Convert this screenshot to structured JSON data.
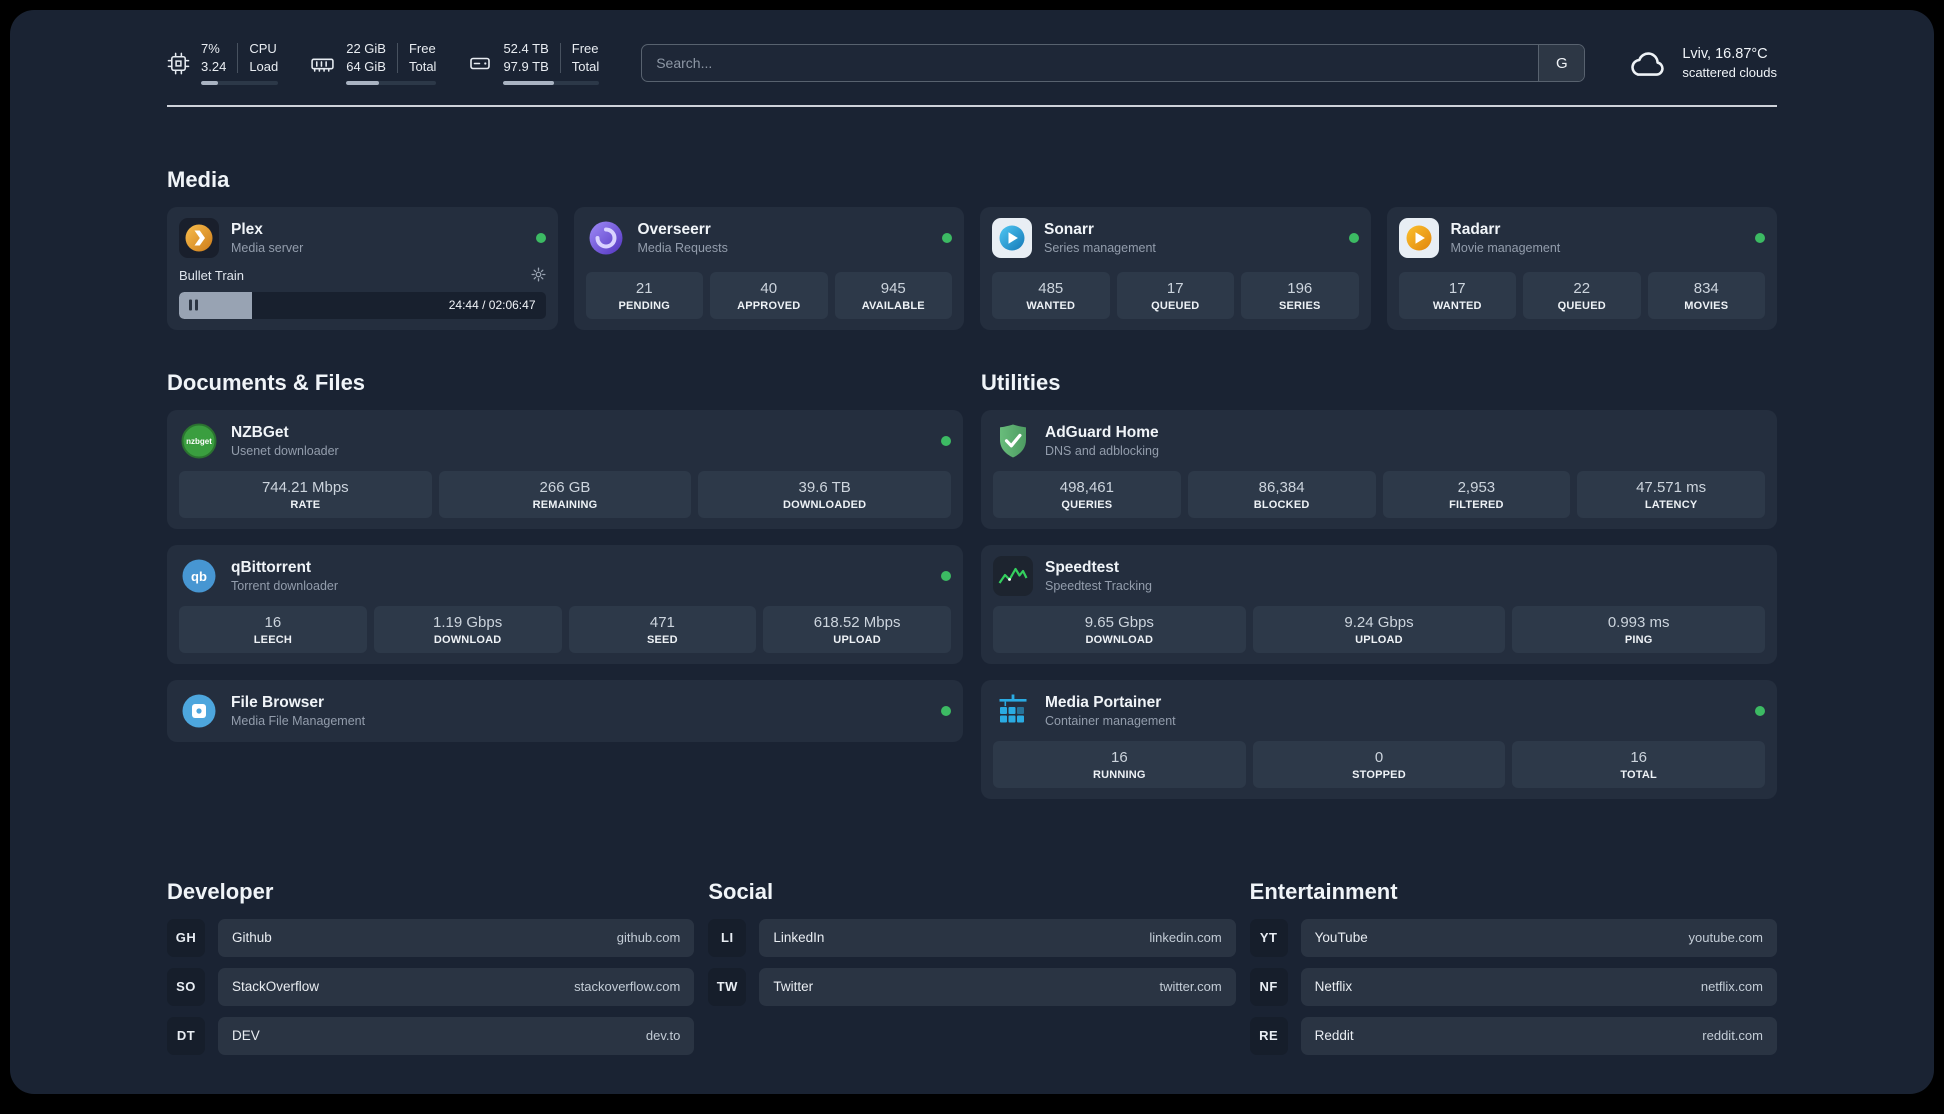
{
  "topbar": {
    "cpu": {
      "values": [
        "7%",
        "3.24"
      ],
      "labels": [
        "CPU",
        "Load"
      ],
      "progress": "22%"
    },
    "ram": {
      "values": [
        "22 GiB",
        "64 GiB"
      ],
      "labels": [
        "Free",
        "Total"
      ],
      "progress": "36%"
    },
    "disk": {
      "values": [
        "52.4 TB",
        "97.9 TB"
      ],
      "labels": [
        "Free",
        "Total"
      ],
      "progress": "53%"
    },
    "search": {
      "placeholder": "Search...",
      "button_label": "G"
    },
    "weather": {
      "location": "Lviv, 16.87°C",
      "condition": "scattered clouds"
    }
  },
  "sections": {
    "media": "Media",
    "documents": "Documents & Files",
    "utilities": "Utilities",
    "developer": "Developer",
    "social": "Social",
    "entertainment": "Entertainment"
  },
  "apps": {
    "plex": {
      "name": "Plex",
      "desc": "Media server",
      "now_playing": "Bullet Train",
      "time": "24:44 / 02:06:47",
      "progress": "20%"
    },
    "overseerr": {
      "name": "Overseerr",
      "desc": "Media Requests",
      "stats": [
        {
          "value": "21",
          "label": "PENDING"
        },
        {
          "value": "40",
          "label": "APPROVED"
        },
        {
          "value": "945",
          "label": "AVAILABLE"
        }
      ]
    },
    "sonarr": {
      "name": "Sonarr",
      "desc": "Series management",
      "stats": [
        {
          "value": "485",
          "label": "WANTED"
        },
        {
          "value": "17",
          "label": "QUEUED"
        },
        {
          "value": "196",
          "label": "SERIES"
        }
      ]
    },
    "radarr": {
      "name": "Radarr",
      "desc": "Movie management",
      "stats": [
        {
          "value": "17",
          "label": "WANTED"
        },
        {
          "value": "22",
          "label": "QUEUED"
        },
        {
          "value": "834",
          "label": "MOVIES"
        }
      ]
    },
    "nzbget": {
      "name": "NZBGet",
      "desc": "Usenet downloader",
      "stats": [
        {
          "value": "744.21 Mbps",
          "label": "RATE"
        },
        {
          "value": "266 GB",
          "label": "REMAINING"
        },
        {
          "value": "39.6 TB",
          "label": "DOWNLOADED"
        }
      ]
    },
    "qbittorrent": {
      "name": "qBittorrent",
      "desc": "Torrent downloader",
      "stats": [
        {
          "value": "16",
          "label": "LEECH"
        },
        {
          "value": "1.19 Gbps",
          "label": "DOWNLOAD"
        },
        {
          "value": "471",
          "label": "SEED"
        },
        {
          "value": "618.52 Mbps",
          "label": "UPLOAD"
        }
      ]
    },
    "filebrowser": {
      "name": "File Browser",
      "desc": "Media File Management"
    },
    "adguard": {
      "name": "AdGuard Home",
      "desc": "DNS and adblocking",
      "stats": [
        {
          "value": "498,461",
          "label": "QUERIES"
        },
        {
          "value": "86,384",
          "label": "BLOCKED"
        },
        {
          "value": "2,953",
          "label": "FILTERED"
        },
        {
          "value": "47.571 ms",
          "label": "LATENCY"
        }
      ]
    },
    "speedtest": {
      "name": "Speedtest",
      "desc": "Speedtest Tracking",
      "stats": [
        {
          "value": "9.65 Gbps",
          "label": "DOWNLOAD"
        },
        {
          "value": "9.24 Gbps",
          "label": "UPLOAD"
        },
        {
          "value": "0.993 ms",
          "label": "PING"
        }
      ]
    },
    "portainer": {
      "name": "Media Portainer",
      "desc": "Container management",
      "stats": [
        {
          "value": "16",
          "label": "RUNNING"
        },
        {
          "value": "0",
          "label": "STOPPED"
        },
        {
          "value": "16",
          "label": "TOTAL"
        }
      ]
    }
  },
  "bookmarks": {
    "developer": {
      "items": [
        {
          "abbr": "GH",
          "name": "Github",
          "url": "github.com"
        },
        {
          "abbr": "SO",
          "name": "StackOverflow",
          "url": "stackoverflow.com"
        },
        {
          "abbr": "DT",
          "name": "DEV",
          "url": "dev.to"
        }
      ]
    },
    "social": {
      "items": [
        {
          "abbr": "LI",
          "name": "LinkedIn",
          "url": "linkedin.com"
        },
        {
          "abbr": "TW",
          "name": "Twitter",
          "url": "twitter.com"
        }
      ]
    },
    "entertainment": {
      "items": [
        {
          "abbr": "YT",
          "name": "YouTube",
          "url": "youtube.com"
        },
        {
          "abbr": "NF",
          "name": "Netflix",
          "url": "netflix.com"
        },
        {
          "abbr": "RE",
          "name": "Reddit",
          "url": "reddit.com"
        }
      ]
    }
  },
  "icons": {
    "cpu-icon": "chip",
    "memory-icon": "ram-stick",
    "disk-icon": "drive",
    "weather-icon": "cloud",
    "settings-icon": "gear",
    "pause-icon": "pause",
    "status-icon": "green-dot",
    "search-engine-icon": "G"
  },
  "colors": {
    "status_online": "#3cba63",
    "accent_green": "#34d05e",
    "portainer_blue": "#2aabe2"
  }
}
